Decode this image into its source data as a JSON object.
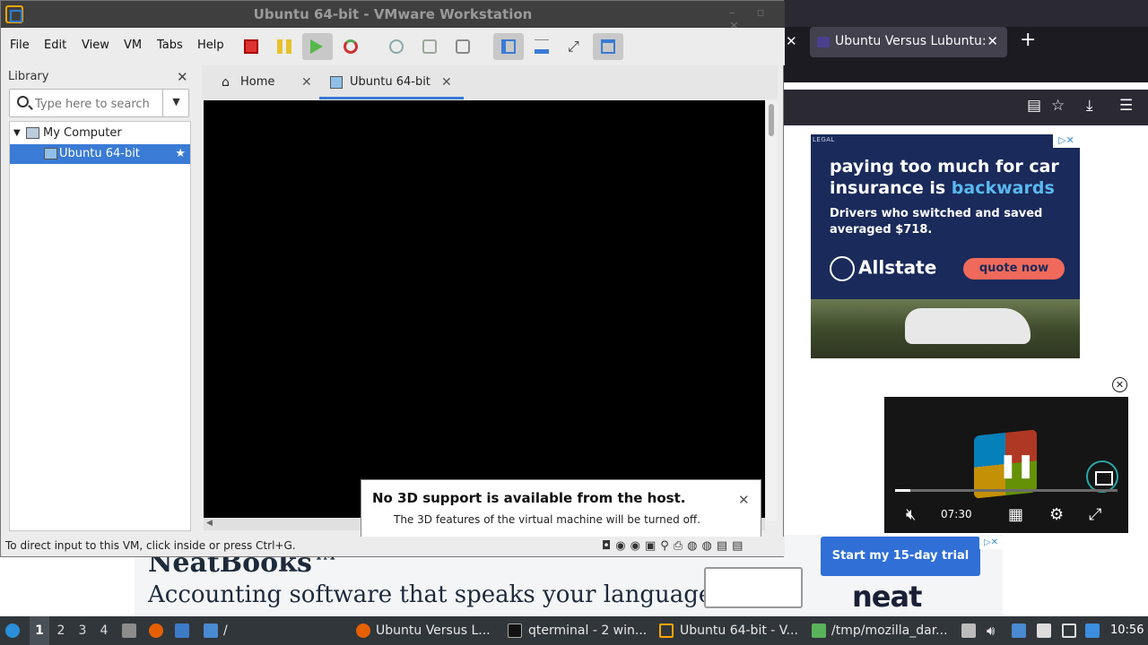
{
  "vmware": {
    "title": "Ubuntu 64-bit - VMware Workstation",
    "menu": [
      "File",
      "Edit",
      "View",
      "VM",
      "Tabs",
      "Help"
    ],
    "library": {
      "header": "Library",
      "search_placeholder": "Type here to search",
      "tree": [
        {
          "label": "My Computer",
          "level": 0,
          "expanded": true,
          "selected": false
        },
        {
          "label": "Ubuntu 64-bit",
          "level": 1,
          "selected": true,
          "favorite": true
        }
      ]
    },
    "tabs": [
      {
        "label": "Home",
        "icon": "home-icon",
        "active": false
      },
      {
        "label": "Ubuntu 64-bit",
        "icon": "vm-icon",
        "active": true
      }
    ],
    "notice": {
      "title": "No 3D support is available from the host.",
      "body": "The 3D features of the virtual machine will be turned off."
    },
    "status_text": "To direct input to this VM, click inside or press Ctrl+G."
  },
  "firefox": {
    "title_fragment": "x",
    "tab_label": "Ubuntu Versus Lubuntu: ",
    "ad": {
      "legal": "LEGAL",
      "headline_a": "paying too much for car insurance is ",
      "headline_b": "backwards",
      "sub": "Drivers who switched and saved averaged $718.",
      "brand": "Allstate",
      "cta": "quote now"
    },
    "video": {
      "time": "07:30",
      "progress": 0.07
    },
    "banner": {
      "brand": "NeatBooks™",
      "tagline": "Accounting software that speaks your language",
      "cta": "Start my 15-day trial",
      "logo": "neat"
    }
  },
  "taskbar": {
    "workspaces": [
      "1",
      "2",
      "3",
      "4"
    ],
    "current_workspace": "1",
    "path_label": "/",
    "windows": [
      {
        "label": "Ubuntu Versus L...",
        "icon": "firefox-icon"
      },
      {
        "label": "qterminal - 2 win...",
        "icon": "terminal-icon"
      },
      {
        "label": "Ubuntu 64-bit - V...",
        "icon": "vmware-icon"
      },
      {
        "label": "/tmp/mozilla_dar...",
        "icon": "file-icon"
      }
    ],
    "clock": "10:56"
  },
  "colors": {
    "accent": "#3a7bd5",
    "ad_bg": "#1a2a5a",
    "ad_cta": "#f06a5b",
    "banner_cta": "#2f6fd6",
    "taskbar": "#31363b"
  }
}
